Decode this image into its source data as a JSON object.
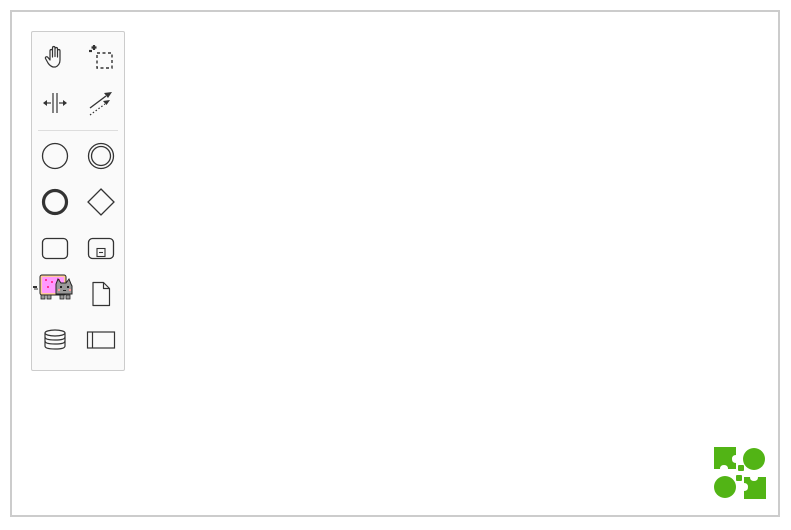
{
  "palette": {
    "tools": [
      {
        "id": "hand-tool",
        "icon": "hand-icon"
      },
      {
        "id": "lasso-tool",
        "icon": "lasso-icon"
      },
      {
        "id": "space-tool",
        "icon": "space-tool-icon"
      },
      {
        "id": "global-connect-tool",
        "icon": "connect-icon"
      },
      {
        "id": "start-event",
        "icon": "start-event-icon"
      },
      {
        "id": "intermediate-event",
        "icon": "intermediate-event-icon"
      },
      {
        "id": "end-event",
        "icon": "end-event-icon"
      },
      {
        "id": "exclusive-gateway",
        "icon": "gateway-icon"
      },
      {
        "id": "task",
        "icon": "task-icon"
      },
      {
        "id": "subprocess",
        "icon": "subprocess-icon"
      },
      {
        "id": "nyan-cat",
        "icon": "nyan-cat-icon"
      },
      {
        "id": "data-object",
        "icon": "data-object-icon"
      },
      {
        "id": "data-store",
        "icon": "data-store-icon"
      },
      {
        "id": "participant",
        "icon": "participant-icon"
      }
    ]
  },
  "colors": {
    "icon_stroke": "#333333",
    "palette_bg": "#fafafa",
    "palette_border": "#cccccc",
    "canvas_border": "#cccccc",
    "logo_green": "#52b415",
    "nyan_pink": "#ff99ff",
    "nyan_gray": "#999999"
  }
}
